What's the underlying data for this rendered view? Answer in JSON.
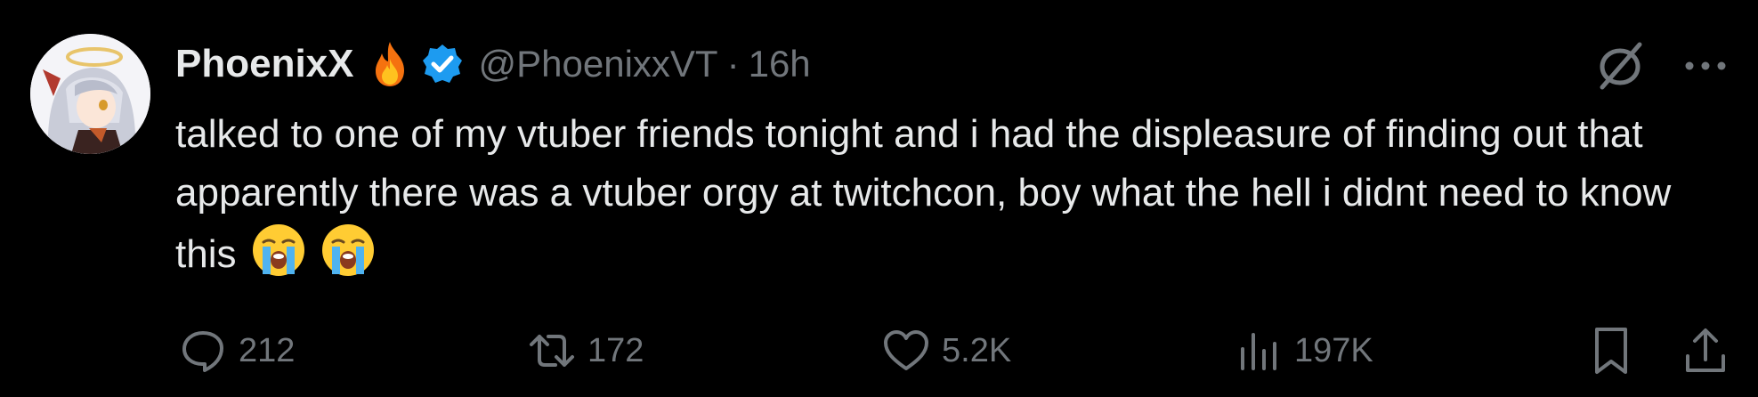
{
  "tweet": {
    "author_name": "PhoenixX",
    "handle": "@PhoenixxVT",
    "separator": "·",
    "time": "16h",
    "name_emoji_icon": "fire-icon",
    "verified_icon": "verified-badge-icon",
    "text": "talked to one of my vtuber friends tonight and i had the displeasure of finding out that apparently there was a vtuber orgy at twitchcon, boy what the hell i didnt need to know this",
    "trailing_emoji": [
      "loudly-crying-face-emoji",
      "loudly-crying-face-emoji"
    ]
  },
  "actions": {
    "replies": "212",
    "retweets": "172",
    "likes": "5.2K",
    "views": "197K"
  },
  "colors": {
    "background": "#000000",
    "text": "#e7e9ea",
    "muted": "#71767b",
    "verified": "#1d9bf0"
  }
}
